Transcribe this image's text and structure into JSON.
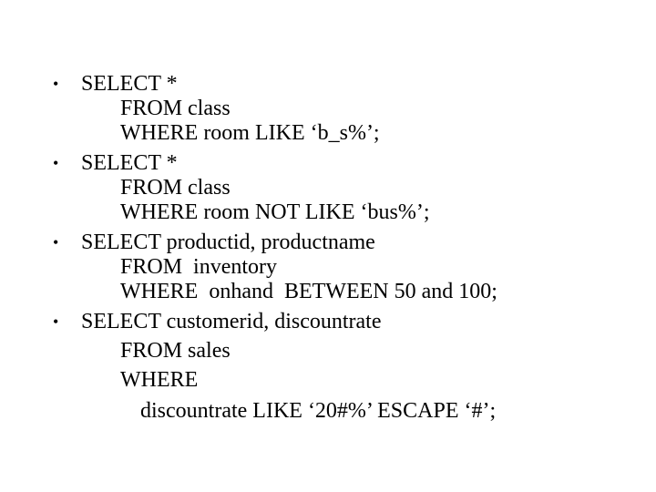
{
  "slide": {
    "bullet_glyph": "•",
    "items": [
      {
        "select": "SELECT *",
        "from": "FROM class",
        "where": "WHERE room LIKE ‘b_s%’;"
      },
      {
        "select": "SELECT *",
        "from": "FROM class",
        "where": "WHERE room NOT LIKE ‘bus%’;"
      },
      {
        "select": "SELECT productid, productname",
        "from": "FROM  inventory",
        "where": "WHERE  onhand  BETWEEN 50 and 100;"
      },
      {
        "select": "SELECT customerid, discountrate",
        "from": "FROM sales",
        "where": "WHERE",
        "where_cont": "discountrate LIKE ‘20#%’ ESCAPE ‘#’;"
      }
    ]
  }
}
